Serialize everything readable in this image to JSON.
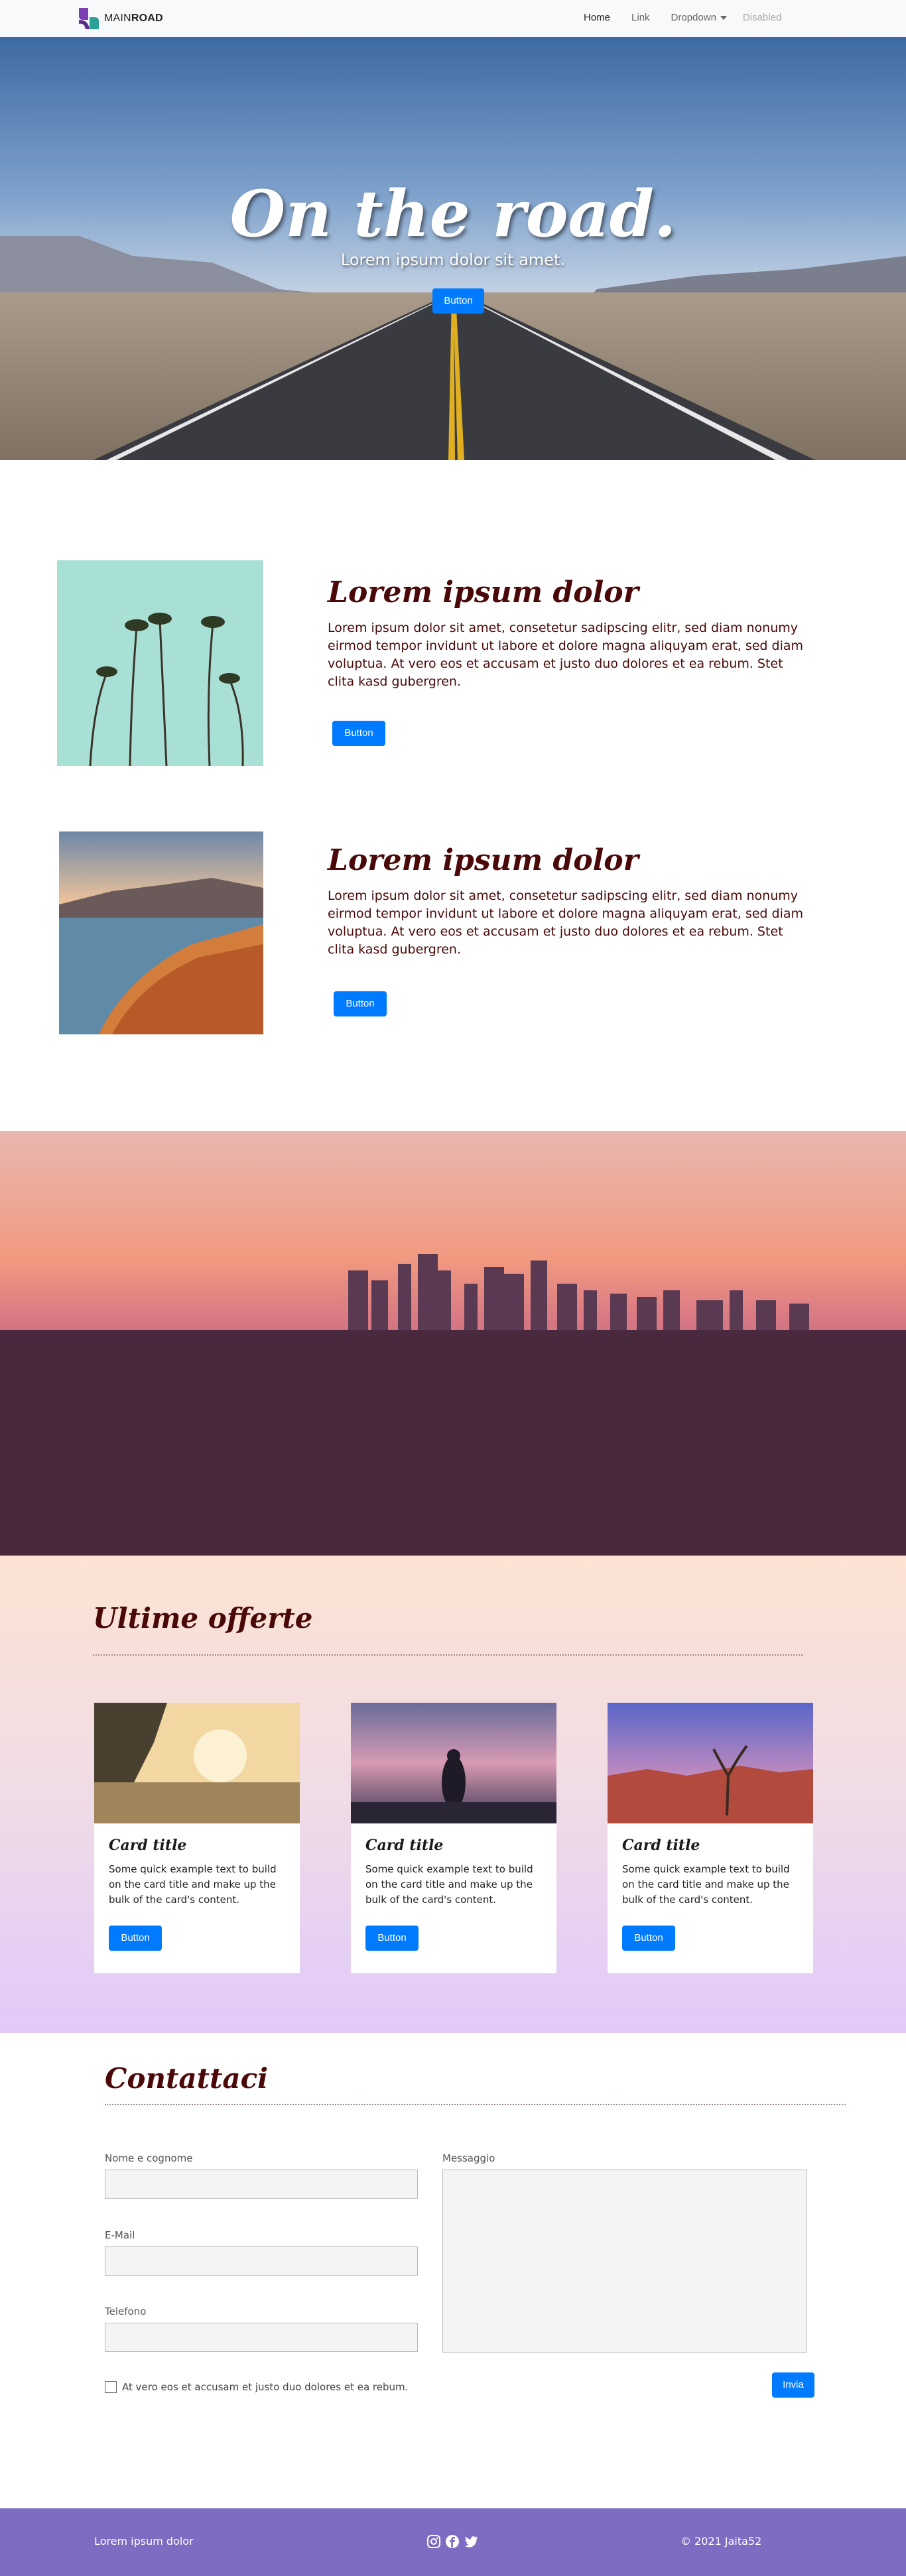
{
  "nav": {
    "brand_light": "MAIN",
    "brand_bold": "ROAD",
    "links": [
      {
        "label": "Home",
        "state": "active"
      },
      {
        "label": "Link",
        "state": "normal"
      },
      {
        "label": "Dropdown",
        "state": "dropdown"
      },
      {
        "label": "Disabled",
        "state": "disabled"
      }
    ]
  },
  "hero": {
    "title": "On the road.",
    "subtitle": "Lorem ipsum dolor sit amet.",
    "button": "Button"
  },
  "features": [
    {
      "image": "palm-trees",
      "title": "Lorem ipsum dolor",
      "text": "Lorem ipsum dolor sit amet, consetetur sadipscing elitr, sed diam nonumy eirmod tempor invidunt ut labore et dolore magna aliquyam erat, sed diam voluptua. At vero eos et accusam et justo duo dolores et ea rebum. Stet clita kasd gubergren.",
      "button": "Button"
    },
    {
      "image": "beach-sunset",
      "title": "Lorem ipsum dolor",
      "text": "Lorem ipsum dolor sit amet, consetetur sadipscing elitr, sed diam nonumy eirmod tempor invidunt ut labore et dolore magna aliquyam erat, sed diam voluptua. At vero eos et accusam et justo duo dolores et ea rebum. Stet clita kasd gubergren.",
      "button": "Button"
    }
  ],
  "offers": {
    "title": "Ultime offerte",
    "cards": [
      {
        "image": "sunset-surfers",
        "title": "Card title",
        "text": "Some quick example text to build on the card title and make up the bulk of the card's content.",
        "button": "Button"
      },
      {
        "image": "silhouette-dusk",
        "title": "Card title",
        "text": "Some quick example text to build on the card title and make up the bulk of the card's content.",
        "button": "Button"
      },
      {
        "image": "desert-tree",
        "title": "Card title",
        "text": "Some quick example text to build on the card title and make up the bulk of the card's content.",
        "button": "Button"
      }
    ]
  },
  "contact": {
    "title": "Contattaci",
    "name_label": "Nome e cognome",
    "email_label": "E-Mail",
    "phone_label": "Telefono",
    "message_label": "Messaggio",
    "checkbox_label": "At vero eos et accusam et justo duo dolores et ea rebum.",
    "submit": "Invia"
  },
  "footer": {
    "left": "Lorem ipsum dolor",
    "icons": [
      "instagram-icon",
      "facebook-icon",
      "twitter-icon"
    ],
    "right": "© 2021 Jaita52"
  },
  "colors": {
    "primary": "#007bff",
    "heading": "#4a0808",
    "footer": "#7d6cc2",
    "navbar": "#f8f9fa"
  }
}
